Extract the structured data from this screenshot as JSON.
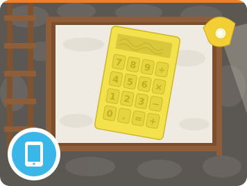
{
  "scene": {
    "board_color": "#f1eee7",
    "frame_color": "#8a5a35",
    "stone_color": "#5a5652",
    "calculator_color": "#f2e24a",
    "lamp_color": "#f6d73a"
  },
  "calculator": {
    "keys": [
      "7",
      "8",
      "9",
      "÷",
      "4",
      "5",
      "6",
      "×",
      "1",
      "2",
      "3",
      "−",
      "0",
      ".",
      "=",
      "+"
    ]
  },
  "device_badge": {
    "icon": "tablet-icon",
    "color": "#3bb6e8"
  }
}
